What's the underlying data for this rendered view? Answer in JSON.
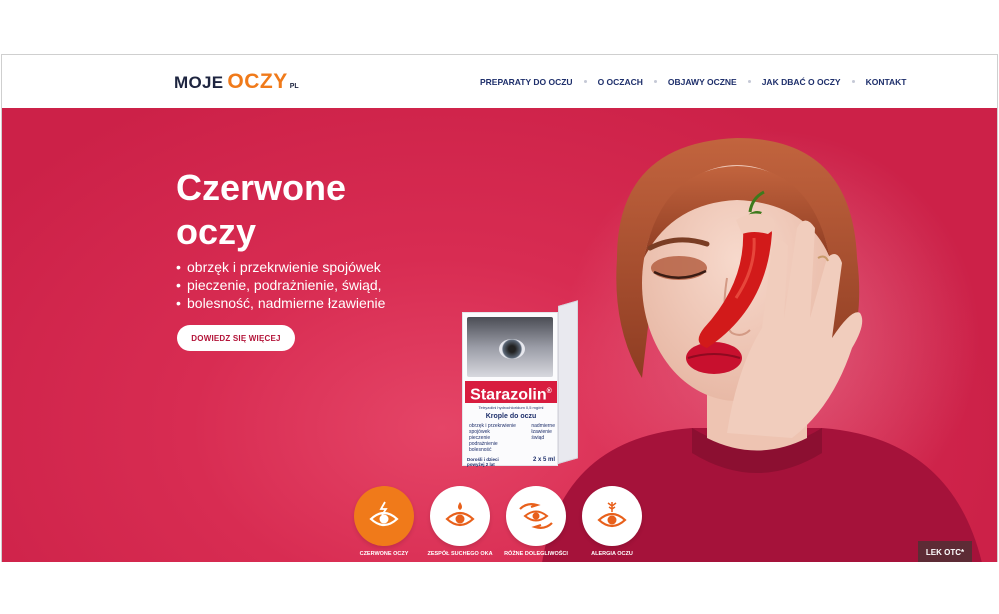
{
  "header": {
    "logo": {
      "moje": "MOJE",
      "oczy": "OCZY",
      "pl": "PL"
    },
    "nav": [
      {
        "label": "PREPARATY DO OCZU"
      },
      {
        "label": "O OCZACH"
      },
      {
        "label": "OBJAWY OCZNE"
      },
      {
        "label": "JAK DBAĆ O OCZY"
      },
      {
        "label": "KONTAKT"
      }
    ]
  },
  "hero": {
    "title_line1": "Czerwone",
    "title_line2": "oczy",
    "bullets": [
      "obrzęk i przekrwienie spojówek",
      "pieczenie, podrażnienie, świąd,",
      "bolesność, nadmierne łzawienie"
    ],
    "cta_label": "DOWIEDZ SIĘ WIĘCEJ"
  },
  "product": {
    "brand": "Starazolin",
    "registered": "®",
    "substance": "Tetryzolini hydrochloridum 0,5 mg/ml",
    "heading": "Krople do oczu",
    "items_left": [
      "obrzęk i przekrwienie spojówek",
      "pieczenie",
      "podrażnienie",
      "bolesność"
    ],
    "items_right": [
      "nadmierne",
      "łzawienie",
      "świąd"
    ],
    "audience": "Dorośli i dzieci powyżej 2 lat",
    "volume": "2 x 5 ml"
  },
  "symptoms": [
    {
      "label": "CZERWONE OCZY",
      "icon": "red-eye-icon",
      "active": true
    },
    {
      "label": "ZESPÓŁ SUCHEGO OKA",
      "icon": "dry-eye-icon",
      "active": false
    },
    {
      "label": "RÓŻNE DOLEGLIWOŚCI",
      "icon": "hands-eye-icon",
      "active": false
    },
    {
      "label": "ALERGIA OCZU",
      "icon": "allergy-eye-icon",
      "active": false
    }
  ],
  "badge": {
    "label": "LEK OTC*"
  },
  "colors": {
    "accent": "#f07a1a",
    "hero_bg": "#d82c52",
    "nav_text": "#1e2f6b",
    "cta_text": "#b31338"
  }
}
